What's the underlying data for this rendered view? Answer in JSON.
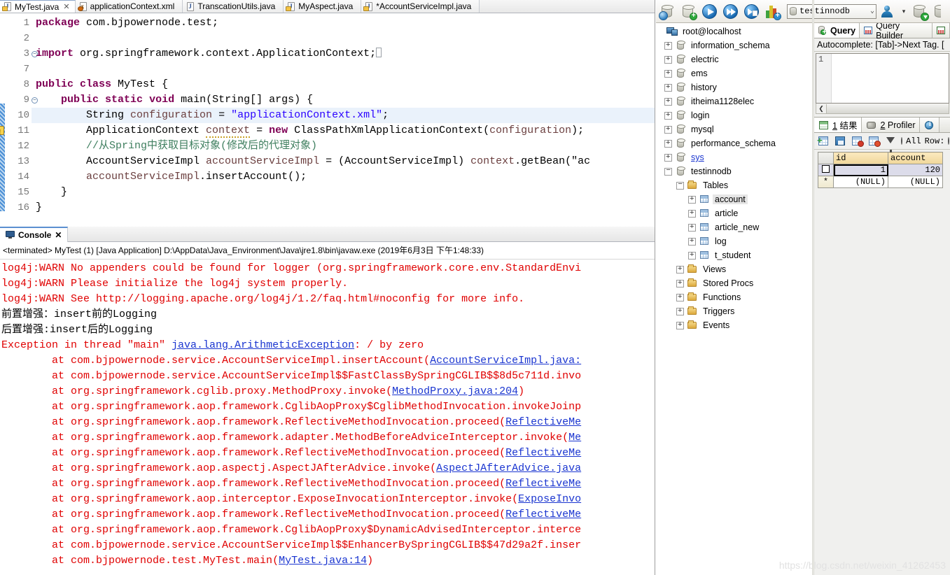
{
  "ide": {
    "tabs": [
      {
        "label": "MyTest.java",
        "type": "java",
        "active": true,
        "closable": true,
        "dirty": false
      },
      {
        "label": "applicationContext.xml",
        "type": "xml",
        "active": false,
        "closable": false,
        "dirty": false
      },
      {
        "label": "TranscationUtils.java",
        "type": "java-plain",
        "active": false,
        "closable": false,
        "dirty": false
      },
      {
        "label": "MyAspect.java",
        "type": "java",
        "active": false,
        "closable": false,
        "dirty": false
      },
      {
        "label": "*AccountServiceImpl.java",
        "type": "java",
        "active": false,
        "closable": false,
        "dirty": true
      }
    ],
    "close_glyph": "✕",
    "code_lines": [
      {
        "num": "1",
        "fold": false,
        "warn": false,
        "highlight": false,
        "text": "package com.bjpowernode.test;"
      },
      {
        "num": "2",
        "fold": false,
        "warn": false,
        "highlight": false,
        "text": ""
      },
      {
        "num": "3",
        "fold": true,
        "warn": false,
        "highlight": false,
        "text": "import org.springframework.context.ApplicationContext;"
      },
      {
        "num": "7",
        "fold": false,
        "warn": false,
        "highlight": false,
        "text": ""
      },
      {
        "num": "8",
        "fold": false,
        "warn": false,
        "highlight": false,
        "text": "public class MyTest {"
      },
      {
        "num": "9",
        "fold": true,
        "warn": false,
        "highlight": false,
        "text": "    public static void main(String[] args) {"
      },
      {
        "num": "10",
        "fold": false,
        "warn": false,
        "highlight": true,
        "text": "        String configuration = \"applicationContext.xml\";"
      },
      {
        "num": "11",
        "fold": false,
        "warn": true,
        "highlight": false,
        "text": "        ApplicationContext context = new ClassPathXmlApplicationContext(configuration);"
      },
      {
        "num": "12",
        "fold": false,
        "warn": false,
        "highlight": false,
        "text": "        //从Spring中获取目标对象(修改后的代理对象)"
      },
      {
        "num": "13",
        "fold": false,
        "warn": false,
        "highlight": false,
        "text": "        AccountServiceImpl accountServiceImpl = (AccountServiceImpl) context.getBean(\"ac"
      },
      {
        "num": "14",
        "fold": false,
        "warn": false,
        "highlight": false,
        "text": "        accountServiceImpl.insertAccount();"
      },
      {
        "num": "15",
        "fold": false,
        "warn": false,
        "highlight": false,
        "text": "    }"
      },
      {
        "num": "16",
        "fold": false,
        "warn": false,
        "highlight": false,
        "text": "}"
      }
    ],
    "console": {
      "tab_label": "Console",
      "close_glyph": "✕",
      "header": "<terminated> MyTest (1) [Java Application] D:\\AppData\\Java_Environment\\Java\\jre1.8\\bin\\javaw.exe (2019年6月3日 下午1:48:33)",
      "lines": [
        {
          "color": "red",
          "text": "log4j:WARN No appenders could be found for logger (org.springframework.core.env.StandardEnvi"
        },
        {
          "color": "red",
          "text": "log4j:WARN Please initialize the log4j system properly."
        },
        {
          "color": "red",
          "text": "log4j:WARN See http://logging.apache.org/log4j/1.2/faq.html#noconfig for more info."
        },
        {
          "color": "black",
          "text": "前置增强：insert前的Logging"
        },
        {
          "color": "black",
          "text": "后置增强:insert后的Logging"
        },
        {
          "color": "red",
          "text": "Exception in thread \"main\" ",
          "link": "java.lang.ArithmeticException",
          "tail": ": / by zero"
        },
        {
          "color": "red",
          "text": "        at com.bjpowernode.service.AccountServiceImpl.insertAccount(",
          "link": "AccountServiceImpl.java:",
          "tail": ""
        },
        {
          "color": "red",
          "text": "        at com.bjpowernode.service.AccountServiceImpl$$FastClassBySpringCGLIB$$8d5c711d.invo",
          "link": "",
          "tail": ""
        },
        {
          "color": "red",
          "text": "        at org.springframework.cglib.proxy.MethodProxy.invoke(",
          "link": "MethodProxy.java:204",
          "tail": ")"
        },
        {
          "color": "red",
          "text": "        at org.springframework.aop.framework.CglibAopProxy$CglibMethodInvocation.invokeJoinp",
          "link": "",
          "tail": ""
        },
        {
          "color": "red",
          "text": "        at org.springframework.aop.framework.ReflectiveMethodInvocation.proceed(",
          "link": "ReflectiveMe",
          "tail": ""
        },
        {
          "color": "red",
          "text": "        at org.springframework.aop.framework.adapter.MethodBeforeAdviceInterceptor.invoke(",
          "link": "Me",
          "tail": ""
        },
        {
          "color": "red",
          "text": "        at org.springframework.aop.framework.ReflectiveMethodInvocation.proceed(",
          "link": "ReflectiveMe",
          "tail": ""
        },
        {
          "color": "red",
          "text": "        at org.springframework.aop.aspectj.AspectJAfterAdvice.invoke(",
          "link": "AspectJAfterAdvice.java",
          "tail": ""
        },
        {
          "color": "red",
          "text": "        at org.springframework.aop.framework.ReflectiveMethodInvocation.proceed(",
          "link": "ReflectiveMe",
          "tail": ""
        },
        {
          "color": "red",
          "text": "        at org.springframework.aop.interceptor.ExposeInvocationInterceptor.invoke(",
          "link": "ExposeInvo",
          "tail": ""
        },
        {
          "color": "red",
          "text": "        at org.springframework.aop.framework.ReflectiveMethodInvocation.proceed(",
          "link": "ReflectiveMe",
          "tail": ""
        },
        {
          "color": "red",
          "text": "        at org.springframework.aop.framework.CglibAopProxy$DynamicAdvisedInterceptor.interce",
          "link": "",
          "tail": ""
        },
        {
          "color": "red",
          "text": "        at com.bjpowernode.service.AccountServiceImpl$$EnhancerBySpringCGLIB$$47d29a2f.inser",
          "link": "",
          "tail": ""
        },
        {
          "color": "red",
          "text": "        at com.bjpowernode.test.MyTest.main(",
          "link": "MyTest.java:14",
          "tail": ")"
        }
      ]
    }
  },
  "sqlyog": {
    "toolbar": {
      "buttons": [
        {
          "name": "new-connection-icon"
        },
        {
          "name": "new-query-tab-icon"
        },
        {
          "name": "execute-query-icon"
        },
        {
          "name": "execute-all-queries-icon"
        },
        {
          "name": "execute-query-new-tab-icon"
        },
        {
          "name": "query-analysis-icon"
        }
      ],
      "db_selector_value": "testinnodb",
      "db_selector_chevron": "⌄",
      "user_manager_caret": "▾",
      "right_buttons": [
        {
          "name": "import-data-icon"
        },
        {
          "name": "export-data-icon"
        }
      ]
    },
    "tree": [
      {
        "label": "root@localhost",
        "icon": "server",
        "expander": "none",
        "indent": 0,
        "selected": false,
        "link": false
      },
      {
        "label": "information_schema",
        "icon": "db",
        "expander": "plus",
        "indent": 1,
        "selected": false,
        "link": false
      },
      {
        "label": "electric",
        "icon": "db",
        "expander": "plus",
        "indent": 1,
        "selected": false,
        "link": false
      },
      {
        "label": "ems",
        "icon": "db",
        "expander": "plus",
        "indent": 1,
        "selected": false,
        "link": false
      },
      {
        "label": "history",
        "icon": "db",
        "expander": "plus",
        "indent": 1,
        "selected": false,
        "link": false
      },
      {
        "label": "itheima1128elec",
        "icon": "db",
        "expander": "plus",
        "indent": 1,
        "selected": false,
        "link": false
      },
      {
        "label": "login",
        "icon": "db",
        "expander": "plus",
        "indent": 1,
        "selected": false,
        "link": false
      },
      {
        "label": "mysql",
        "icon": "db",
        "expander": "plus",
        "indent": 1,
        "selected": false,
        "link": false
      },
      {
        "label": "performance_schema",
        "icon": "db",
        "expander": "plus",
        "indent": 1,
        "selected": false,
        "link": false
      },
      {
        "label": "sys",
        "icon": "db",
        "expander": "plus",
        "indent": 1,
        "selected": false,
        "link": true
      },
      {
        "label": "testinnodb",
        "icon": "db",
        "expander": "minus",
        "indent": 1,
        "selected": false,
        "link": false
      },
      {
        "label": "Tables",
        "icon": "folder",
        "expander": "minus",
        "indent": 2,
        "selected": false,
        "link": false
      },
      {
        "label": "account",
        "icon": "table",
        "expander": "plus",
        "indent": 3,
        "selected": true,
        "link": false
      },
      {
        "label": "article",
        "icon": "table",
        "expander": "plus",
        "indent": 3,
        "selected": false,
        "link": false
      },
      {
        "label": "article_new",
        "icon": "table",
        "expander": "plus",
        "indent": 3,
        "selected": false,
        "link": false
      },
      {
        "label": "log",
        "icon": "table",
        "expander": "plus",
        "indent": 3,
        "selected": false,
        "link": false
      },
      {
        "label": "t_student",
        "icon": "table",
        "expander": "plus",
        "indent": 3,
        "selected": false,
        "link": false
      },
      {
        "label": "Views",
        "icon": "folder",
        "expander": "plus",
        "indent": 2,
        "selected": false,
        "link": false
      },
      {
        "label": "Stored Procs",
        "icon": "folder",
        "expander": "plus",
        "indent": 2,
        "selected": false,
        "link": false
      },
      {
        "label": "Functions",
        "icon": "folder",
        "expander": "plus",
        "indent": 2,
        "selected": false,
        "link": false
      },
      {
        "label": "Triggers",
        "icon": "folder",
        "expander": "plus",
        "indent": 2,
        "selected": false,
        "link": false
      },
      {
        "label": "Events",
        "icon": "folder",
        "expander": "plus",
        "indent": 2,
        "selected": false,
        "link": false
      }
    ],
    "query_tabs": [
      {
        "label": "Query",
        "icon": "query",
        "active": true
      },
      {
        "label": "Query Builder",
        "icon": "builder",
        "active": false
      },
      {
        "label": "",
        "icon": "schema",
        "active": false
      }
    ],
    "autocomplete_hint": "Autocomplete: [Tab]->Next Tag. [",
    "sql_line_number": "1",
    "sql_text": "",
    "hscroll_left_glyph": "❮",
    "result_tabs": [
      {
        "num": "1",
        "label": "结果",
        "icon": "result",
        "active": true
      },
      {
        "num": "2",
        "label": "Profiler",
        "icon": "profiler",
        "active": false
      },
      {
        "num": "",
        "label": "",
        "icon": "info",
        "active": false
      }
    ],
    "result_bar": {
      "all_label": "All",
      "row_label": "Row:"
    },
    "grid": {
      "columns": [
        "id",
        "account"
      ],
      "rows": [
        {
          "selected": true,
          "marker": "box",
          "cells": [
            "1",
            "120"
          ]
        },
        {
          "selected": false,
          "marker": "*",
          "cells": [
            "(NULL)",
            "(NULL)"
          ]
        }
      ]
    }
  },
  "watermark": "https://blog.csdn.net/weixin_41262453"
}
